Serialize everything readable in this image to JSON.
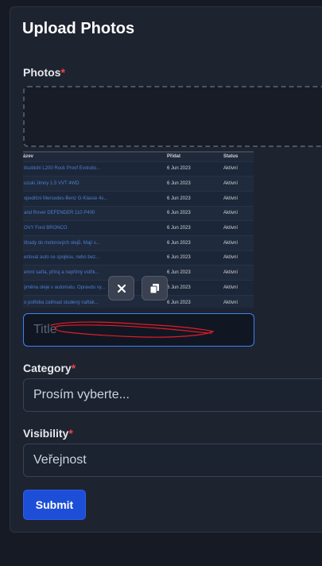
{
  "form": {
    "title": "Upload Photos",
    "photos_label": "Photos",
    "required_mark": "*",
    "title_placeholder": "Title",
    "category_label": "Category",
    "category_value": "Prosím vyberte...",
    "visibility_label": "Visibility",
    "visibility_value": "Veřejnost",
    "submit_label": "Submit"
  },
  "thumbnail": {
    "headers": [
      "ázev",
      "Přidat",
      "Status"
    ],
    "rows": [
      {
        "name": "itsubishi L200 Rock Proof Evolutio...",
        "date": "6 Jun 2023",
        "status": "Aktivní"
      },
      {
        "name": "uzuki Jimny 1.5 VVT 4WD",
        "date": "6 Jun 2023",
        "status": "Aktivní"
      },
      {
        "name": "xpediční Mercedes-Benz G-Klasse 4x...",
        "date": "6 Jun 2023",
        "status": "Aktivní"
      },
      {
        "name": "and Rover DEFENDER 110 P400",
        "date": "6 Jun 2023",
        "status": "Aktivní"
      },
      {
        "name": "OVY Ford BRONCO",
        "date": "6 Jun 2023",
        "status": "Aktivní"
      },
      {
        "name": "iltrady do motorových olejů. Mají s...",
        "date": "6 Jun 2023",
        "status": "Aktivní"
      },
      {
        "name": "ertovat auto se spojkou, nebo bez...",
        "date": "6 Jun 2023",
        "status": "Aktivní"
      },
      {
        "name": "emní saťta, příruj a nepřímý vstřik...",
        "date": "6 Jun 2023",
        "status": "Aktivní"
      },
      {
        "name": "ýměna oleje v automatu. Opravdu vy...",
        "date": "6 Jun 2023",
        "status": "Aktivní"
      },
      {
        "name": "o potřeba zatihuat studený nafták...",
        "date": "6 Jun 2023",
        "status": "Aktivní"
      }
    ]
  },
  "icons": {
    "remove": "close-icon",
    "copy": "copy-icon"
  },
  "colors": {
    "accent": "#1d4ed8",
    "required": "#ef4444",
    "focus_border": "#3b82f6",
    "scribble": "#e11d2a"
  }
}
